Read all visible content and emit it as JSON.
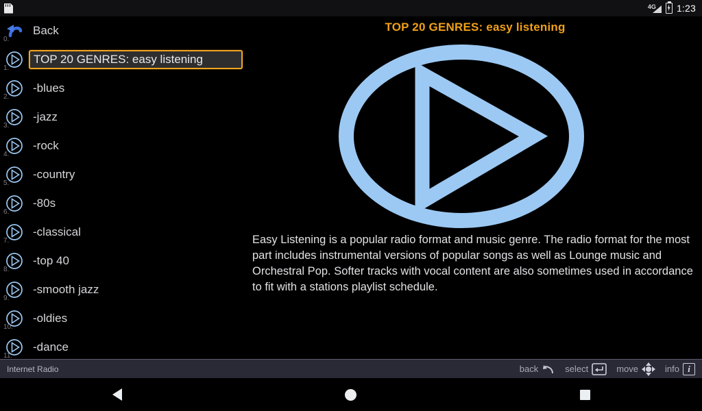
{
  "status_bar": {
    "storage_icon": "sd-card-icon",
    "network_label": "4G",
    "signal_icon": "signal-bars-icon",
    "battery_icon": "battery-charging-icon",
    "time": "1:23"
  },
  "list": {
    "rows": [
      {
        "num": "0.",
        "label": "Back",
        "icon": "back-arrow-icon",
        "selected": false
      },
      {
        "num": "1.",
        "label": "TOP 20 GENRES: easy listening",
        "icon": "play-circle-icon",
        "selected": true
      },
      {
        "num": "2.",
        "label": "-blues",
        "icon": "play-circle-icon",
        "selected": false
      },
      {
        "num": "3.",
        "label": "-jazz",
        "icon": "play-circle-icon",
        "selected": false
      },
      {
        "num": "4.",
        "label": "-rock",
        "icon": "play-circle-icon",
        "selected": false
      },
      {
        "num": "5.",
        "label": "-country",
        "icon": "play-circle-icon",
        "selected": false
      },
      {
        "num": "6.",
        "label": "-80s",
        "icon": "play-circle-icon",
        "selected": false
      },
      {
        "num": "7.",
        "label": "-classical",
        "icon": "play-circle-icon",
        "selected": false
      },
      {
        "num": "8.",
        "label": "-top 40",
        "icon": "play-circle-icon",
        "selected": false
      },
      {
        "num": "9.",
        "label": "-smooth jazz",
        "icon": "play-circle-icon",
        "selected": false
      },
      {
        "num": "10.",
        "label": "-oldies",
        "icon": "play-circle-icon",
        "selected": false
      },
      {
        "num": "11.",
        "label": "-dance",
        "icon": "play-circle-icon",
        "selected": false
      }
    ]
  },
  "detail": {
    "title": "TOP 20 GENRES: easy listening",
    "artwork_icon": "play-circle-large-icon",
    "description": "Easy Listening is a popular radio format and music genre. The radio format for the most part includes instrumental versions of popular songs as well as Lounge music and Orchestral Pop. Softer tracks with vocal content are also sometimes used in accordance to fit with a stations playlist schedule."
  },
  "app_bar": {
    "app_title": "Internet Radio",
    "hints": [
      {
        "label": "back",
        "icon": "undo-arrow-icon"
      },
      {
        "label": "select",
        "icon": "enter-key-icon"
      },
      {
        "label": "move",
        "icon": "dpad-icon"
      },
      {
        "label": "info",
        "icon": "info-i-icon"
      }
    ]
  },
  "nav_bar": {
    "back": "nav-back-icon",
    "home": "nav-home-icon",
    "recents": "nav-recents-icon"
  },
  "colors": {
    "accent_orange": "#f0a018",
    "icon_blue": "#9cc9f3",
    "text_primary": "#d6d6da",
    "appbar_bg": "#2a2a36",
    "selected_bg": "#2e2e2e"
  }
}
